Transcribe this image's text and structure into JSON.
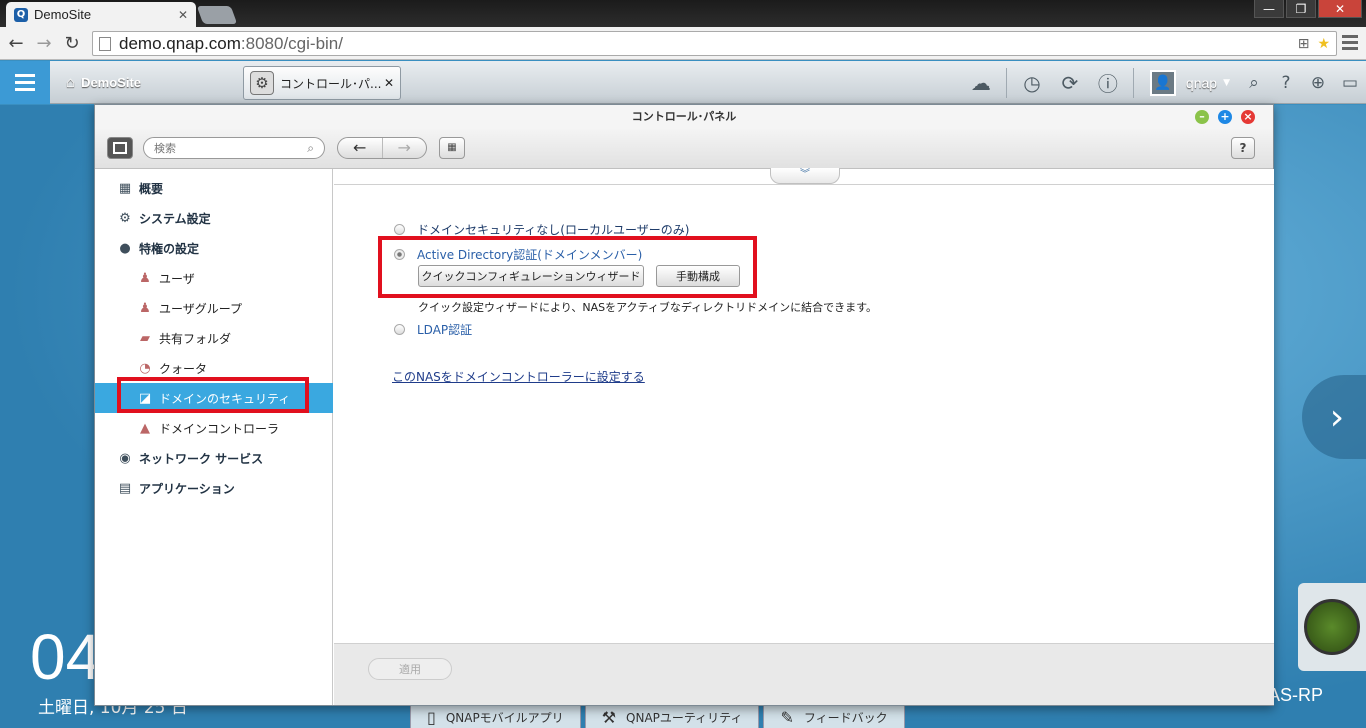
{
  "browser": {
    "tab_title": "DemoSite",
    "tab_close": "✕",
    "url_host": "demo.qnap.com",
    "url_rest": ":8080/cgi-bin/",
    "window_controls": [
      "—",
      "❐",
      "✕"
    ]
  },
  "qnap_bar": {
    "home_label": "DemoSite",
    "app_tab_label": "コントロール･パ...",
    "app_tab_close": "✕",
    "user": "qnap",
    "icons": [
      "cloud-icon",
      "clock-icon",
      "sync-icon",
      "info-icon",
      "search-icon",
      "help-icon",
      "globe-icon",
      "monitor-icon"
    ]
  },
  "desktop": {
    "clock": "04",
    "date": "土曜日, 10月 25 日",
    "dock": [
      {
        "label": "QNAPモバイルアプリ",
        "icon": "phone-icon"
      },
      {
        "label": "QNAPユーティリティ",
        "icon": "hammer-icon"
      },
      {
        "label": "フィードバック",
        "icon": "edit-icon"
      }
    ],
    "right_label": "AS-RP"
  },
  "window": {
    "title": "コントロール･パネル",
    "search_placeholder": "検索",
    "help": "?"
  },
  "sidebar": {
    "items": [
      {
        "label": "概要",
        "icon": "overview-icon",
        "level": 0
      },
      {
        "label": "システム設定",
        "icon": "gear-icon",
        "level": 0
      },
      {
        "label": "特権の設定",
        "icon": "user-icon",
        "level": 0
      },
      {
        "label": "ユーザ",
        "icon": "user-icon",
        "level": 1
      },
      {
        "label": "ユーザグループ",
        "icon": "group-icon",
        "level": 1
      },
      {
        "label": "共有フォルダ",
        "icon": "folder-icon",
        "level": 1
      },
      {
        "label": "クォータ",
        "icon": "quota-icon",
        "level": 1
      },
      {
        "label": "ドメインのセキュリティ",
        "icon": "domain-security-icon",
        "level": 1,
        "active": true
      },
      {
        "label": "ドメインコントローラ",
        "icon": "domain-controller-icon",
        "level": 1
      },
      {
        "label": "ネットワーク サービス",
        "icon": "network-icon",
        "level": 0
      },
      {
        "label": "アプリケーション",
        "icon": "application-icon",
        "level": 0
      }
    ]
  },
  "main": {
    "option_none": "ドメインセキュリティなし(ローカルユーザーのみ)",
    "option_ad": "Active Directory認証(ドメインメンバー)",
    "wizard_button": "クイックコンフィギュレーションウィザード",
    "manual_button": "手動構成",
    "description": "クイック設定ウィザードにより、NASをアクティブなディレクトリドメインに結合できます。",
    "option_ldap": "LDAP認証",
    "dc_link": "このNASをドメインコントローラーに設定する",
    "apply": "適用"
  },
  "colors": {
    "accent": "#3aa8e0",
    "highlight_box": "#e1101e"
  }
}
